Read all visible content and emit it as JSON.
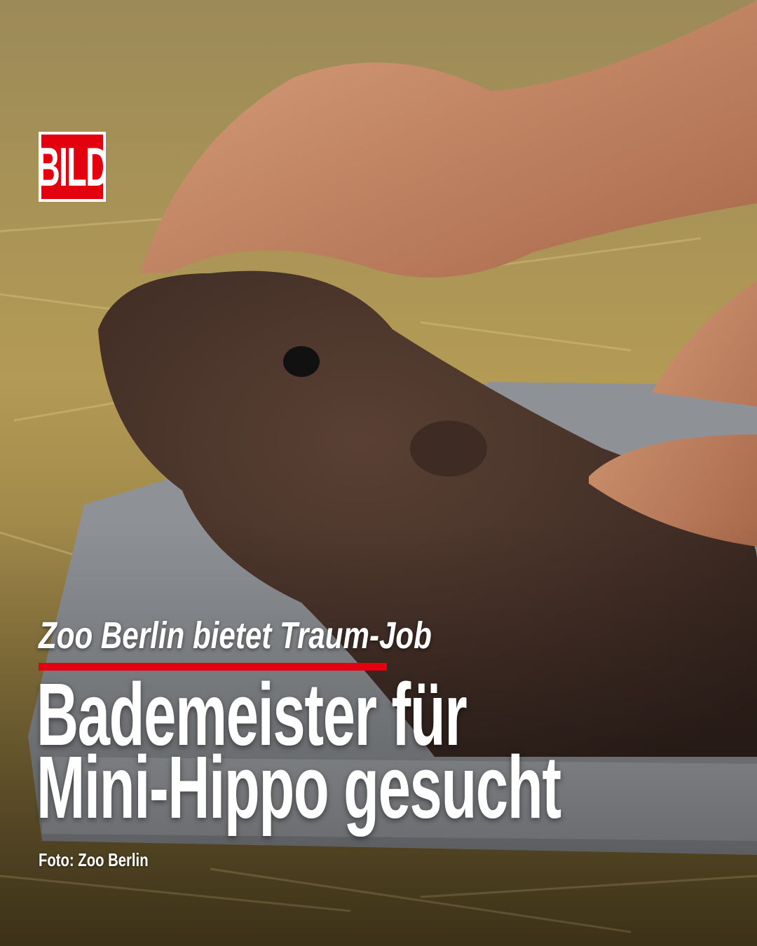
{
  "brand": {
    "logo_text": "BILD",
    "accent_color": "#e3000f"
  },
  "kicker": "Zoo Berlin bietet Traum-Job",
  "headline": {
    "line1": "Bademeister für",
    "line2": "Mini-Hippo gesucht"
  },
  "credit": "Foto: Zoo Berlin"
}
